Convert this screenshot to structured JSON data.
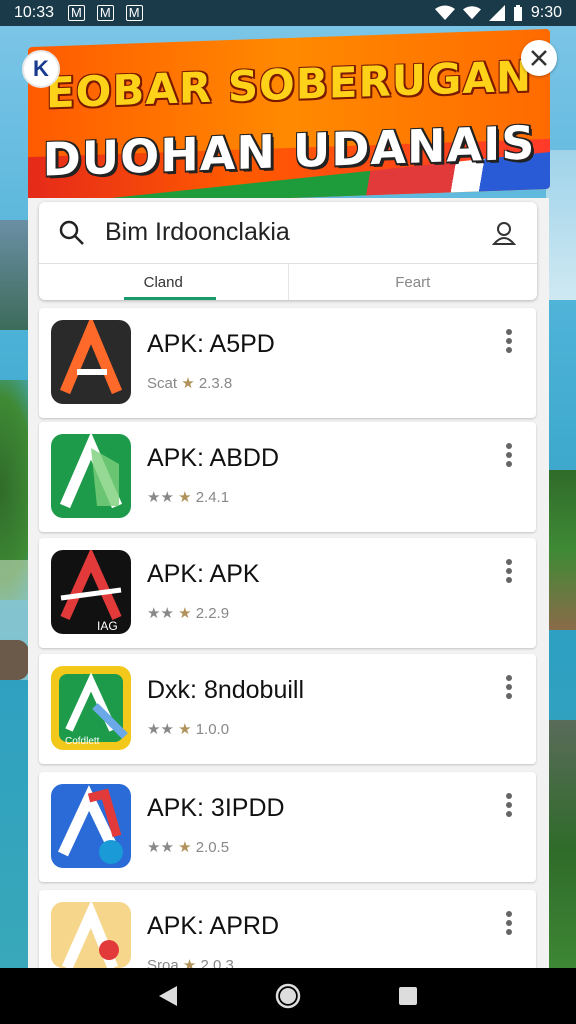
{
  "status_bar": {
    "time": "10:33",
    "notification_icons": [
      "M",
      "M",
      "M"
    ],
    "battery_time": "9:30"
  },
  "banner": {
    "line1": "EOBAR SOBERUGAN",
    "line2": "DUOHAN UDANAIS",
    "logo_text": "K"
  },
  "search": {
    "value": "Bim Irdoonclakia"
  },
  "tabs": [
    {
      "label": "Cland"
    },
    {
      "label": "Feart"
    }
  ],
  "apps": [
    {
      "title": "APK: A5PD",
      "rating": "Scat",
      "stars": "★",
      "count": "2.3.8",
      "icon_color": "#2a2a2a",
      "letter_color": "#ff6a2a",
      "icon_label": ""
    },
    {
      "title": "APK: ABDD",
      "rating": "★★",
      "stars": "★",
      "count": "2.4.1",
      "icon_color": "#1e9b4a",
      "letter_color": "#ffffff",
      "icon_label": ""
    },
    {
      "title": "APK: APK",
      "rating": "★★",
      "stars": "★",
      "count": "2.2.9",
      "icon_color": "#111111",
      "letter_color": "#e23a3a",
      "icon_label": "IAG"
    },
    {
      "title": "Dxk: 8ndobuill",
      "rating": "★★",
      "stars": "★",
      "count": "1.0.0",
      "icon_color": "#f2c81a",
      "letter_color": "#1e9b4a",
      "icon_label": "Cofdlett"
    },
    {
      "title": "APK: 3IPDD",
      "rating": "★★",
      "stars": "★",
      "count": "2.0.5",
      "icon_color": "#2a6bd7",
      "letter_color": "#ffffff",
      "icon_label": ""
    },
    {
      "title": "APK: APRD",
      "rating": "Sroa",
      "stars": "★",
      "count": "2.0.3",
      "icon_color": "#f5d68a",
      "letter_color": "#ffffff",
      "icon_label": ""
    }
  ]
}
